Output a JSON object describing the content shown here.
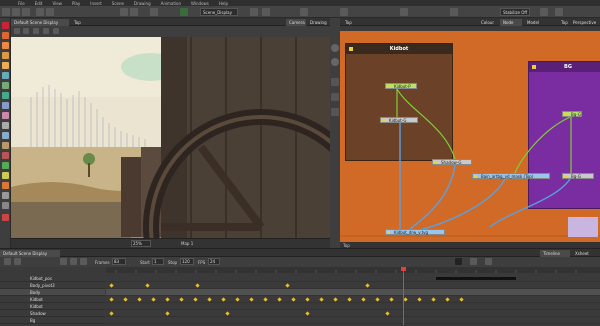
{
  "menubar": {
    "items": [
      "File",
      "Edit",
      "View",
      "Play",
      "Insert",
      "Scene",
      "Drawing",
      "Animation",
      "Windows",
      "Help"
    ]
  },
  "toolbar": {
    "scene_dropdown": "Scene_Display",
    "workspace_dropdown": "Stabilize Off"
  },
  "viewport": {
    "tabs": [
      "Camera",
      "Drawing"
    ],
    "display_dropdown": "Default Scene Display",
    "view_label": "Top",
    "zoom": "25%",
    "status": "Map 1"
  },
  "nodeview": {
    "top_tab": "Top",
    "tabs": [
      "Colour",
      "Node View",
      "Model Controller",
      "Top",
      "Perspective"
    ],
    "footer": "Top",
    "backdrops": [
      {
        "title": "Kidbot",
        "color": "#6b4228"
      },
      {
        "title": "BG",
        "color": "#7a2da0"
      }
    ],
    "nodes": {
      "kidbot_peg": "Kidbot-P",
      "kidbot_g": "Kidbot-G",
      "shadow_g": "Shadow-G",
      "bgg": "Bg-G",
      "comp": "Bain_artbg_vd_mask (Top)",
      "bg_g": "Bg-G",
      "kidbot_drw": "Kidbot_drw_v.tvg"
    },
    "colors": {
      "canvas": "#d06a26"
    }
  },
  "timeline": {
    "tabs": [
      "Default Scene Display"
    ],
    "side_tabs": [
      "Timeline",
      "Xsheet"
    ],
    "controls": {
      "frames_label": "Frames",
      "frames_value": "83",
      "start_label": "Start",
      "start_value": "1",
      "stop_label": "Stop",
      "stop_value": "120",
      "fps_label": "FPS",
      "fps_value": "24"
    },
    "layers": [
      "Kidbot_pos",
      "Body_pivot3",
      "Body",
      "Kidbot",
      "Kidbot",
      "Shadow",
      "Bg"
    ]
  },
  "colors": {
    "accent": "#e8c020",
    "playhead": "#e53c3c"
  }
}
